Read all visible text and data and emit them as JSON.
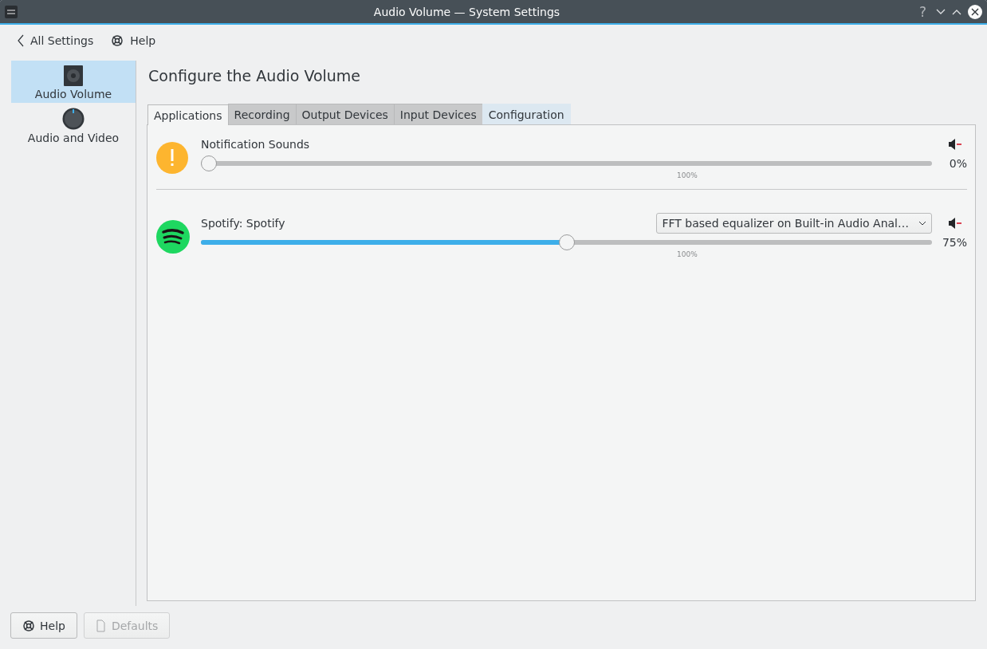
{
  "window": {
    "title": "Audio Volume — System Settings",
    "controls": [
      "?"
    ]
  },
  "toolbar": {
    "back": "All Settings",
    "help": "Help"
  },
  "sidebar": {
    "items": [
      {
        "label": "Audio Volume",
        "kind": "speaker",
        "selected": true
      },
      {
        "label": "Audio and Video",
        "kind": "knob",
        "selected": false
      }
    ]
  },
  "page": {
    "title": "Configure the Audio Volume"
  },
  "tabs": [
    {
      "label": "Applications",
      "selected": true,
      "hovered": false
    },
    {
      "label": "Recording",
      "selected": false,
      "hovered": false
    },
    {
      "label": "Output Devices",
      "selected": false,
      "hovered": false
    },
    {
      "label": "Input Devices",
      "selected": false,
      "hovered": false
    },
    {
      "label": "Configuration",
      "selected": false,
      "hovered": true
    }
  ],
  "streams": [
    {
      "name": "Notification Sounds",
      "kind": "warning",
      "level": 0,
      "reading": "0%",
      "tick_label": "100%"
    },
    {
      "name": "Spotify: Spotify",
      "kind": "spotify",
      "device": "FFT based equalizer on Built-in Audio Anal…",
      "level": 0.5,
      "reading": "75%",
      "tick_label": "100%"
    }
  ],
  "footer": {
    "help": "Help",
    "defaults": {
      "label": "Defaults",
      "disabled": true
    }
  }
}
